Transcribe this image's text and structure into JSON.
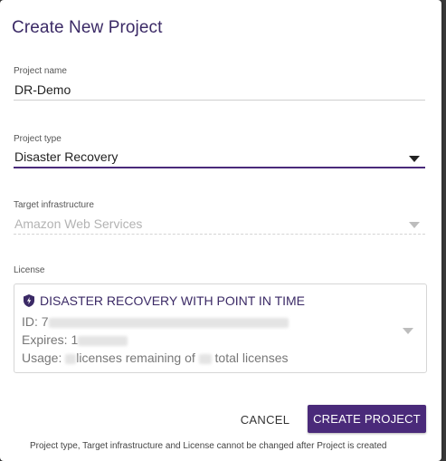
{
  "dialog": {
    "title": "Create New Project"
  },
  "project_name": {
    "label": "Project name",
    "value": "DR-Demo"
  },
  "project_type": {
    "label": "Project type",
    "value": "Disaster Recovery"
  },
  "target_infrastructure": {
    "label": "Target infrastructure",
    "value": "Amazon Web Services"
  },
  "license": {
    "label": "License",
    "name": "DISASTER RECOVERY WITH POINT IN TIME",
    "id_label": "ID:",
    "id_visible_prefix": "7",
    "expires_label": "Expires:",
    "expires_visible_prefix": "1",
    "usage_label": "Usage:",
    "usage_text_mid": "licenses remaining of",
    "usage_text_end": "total licenses"
  },
  "buttons": {
    "cancel": "CANCEL",
    "create": "CREATE PROJECT"
  },
  "footnote": "Project type, Target infrastructure and License cannot be changed after Project is created",
  "colors": {
    "accent": "#4a2a7a",
    "title": "#3b2a66"
  }
}
